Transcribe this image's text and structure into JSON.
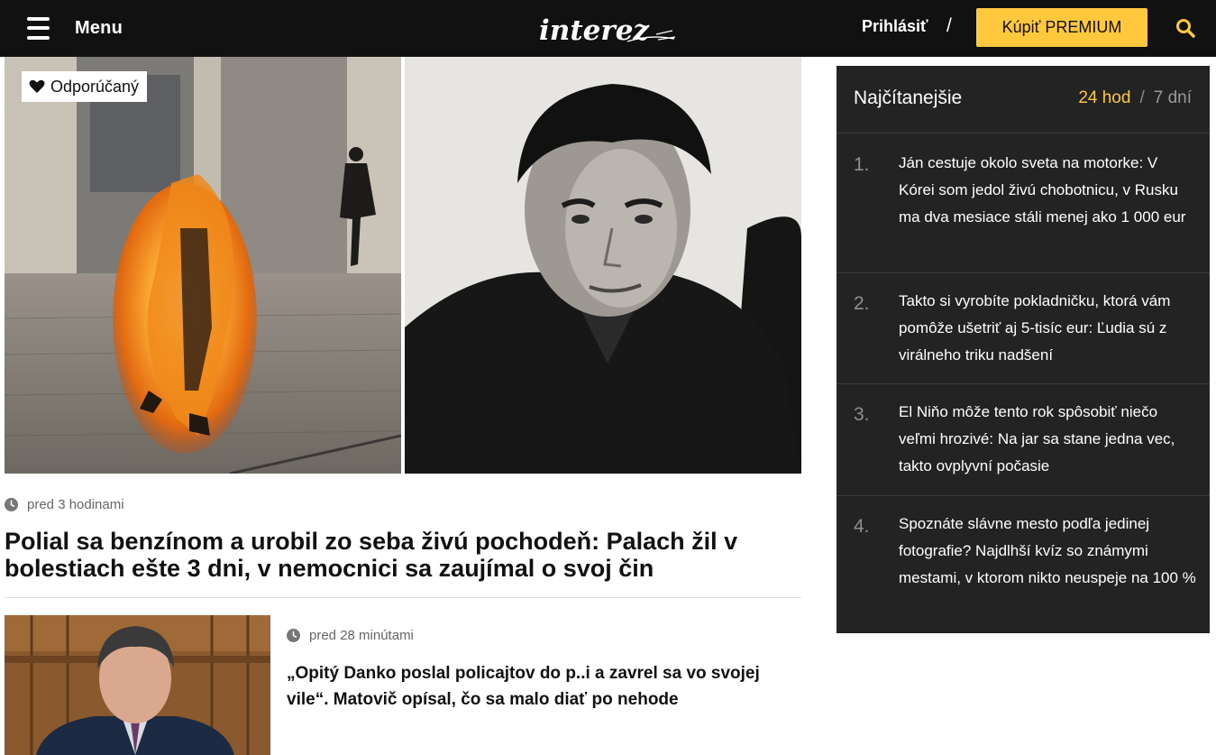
{
  "header": {
    "menu_label": "Menu",
    "logo_text": "interez",
    "login_label": "Prihlásiť",
    "separator": "/",
    "premium_label": "Kúpiť PREMIUM",
    "accent_color": "#ffc83d"
  },
  "hero": {
    "badge_label": "Odporúčaný",
    "time": "pred 3 hodinami",
    "title": "Polial sa benzínom a urobil zo seba živú pochodeň: Palach žil v bolestiach ešte 3 dni, v nemocnici sa zaujímal o svoj čin"
  },
  "article2": {
    "time": "pred 28 minútami",
    "title": "„Opitý Danko poslal policajtov do p..i a zavrel sa vo svojej vile“. Matovič opísal, čo sa malo diať po nehode"
  },
  "sidebar": {
    "title": "Najčítanejšie",
    "tab_active": "24 hod",
    "tab_separator": "/",
    "tab_inactive": "7 dní",
    "items": [
      {
        "num": "1.",
        "text": "Ján cestuje okolo sveta na motorke: V Kórei som jedol živú chobotnicu, v Rusku ma dva mesiace stáli menej ako 1 000 eur"
      },
      {
        "num": "2.",
        "text": "Takto si vyrobíte pokladničku, ktorá vám pomôže ušetriť aj 5-tisíc eur: Ľudia sú z virálneho triku nadšení"
      },
      {
        "num": "3.",
        "text": "El Niňo môže tento rok spôsobiť niečo veľmi hrozivé: Na jar sa stane jedna vec, takto ovplyvní počasie"
      },
      {
        "num": "4.",
        "text": "Spoznáte slávne mesto podľa jedinej fotografie? Najdlhší kvíz so známymi mestami, v ktorom nikto neuspeje na 100 %"
      }
    ]
  },
  "icons": {
    "menu": "hamburger-icon",
    "search": "search-icon",
    "badge": "heart-icon",
    "time": "clock-icon"
  }
}
